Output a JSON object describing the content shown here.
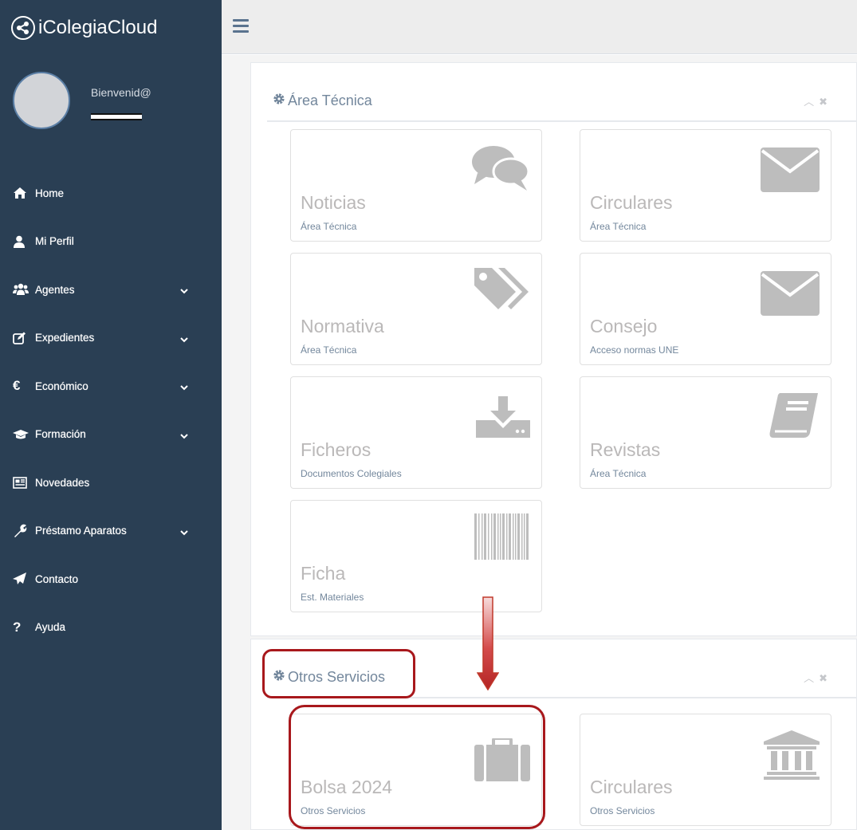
{
  "app": {
    "title": "iColegiaCloud"
  },
  "profile": {
    "welcome": "Bienvenid@"
  },
  "menu": [
    {
      "label": "Home",
      "icon": "home-icon",
      "has_submenu": false
    },
    {
      "label": "Mi Perfil",
      "icon": "user-icon",
      "has_submenu": false
    },
    {
      "label": "Agentes",
      "icon": "users-icon",
      "has_submenu": true
    },
    {
      "label": "Expedientes",
      "icon": "edit-icon",
      "has_submenu": true
    },
    {
      "label": "Económico",
      "icon": "euro-icon",
      "has_submenu": true
    },
    {
      "label": "Formación",
      "icon": "graduation-cap-icon",
      "has_submenu": true
    },
    {
      "label": "Novedades",
      "icon": "newspaper-icon",
      "has_submenu": false
    },
    {
      "label": "Préstamo Aparatos",
      "icon": "wrench-icon",
      "has_submenu": true
    },
    {
      "label": "Contacto",
      "icon": "paper-plane-icon",
      "has_submenu": false
    },
    {
      "label": "Ayuda",
      "icon": "question-icon",
      "has_submenu": false
    }
  ],
  "panels": {
    "area_tecnica": {
      "title": "Área Técnica",
      "tiles": [
        {
          "title": "Noticias",
          "subtitle": "Área Técnica",
          "icon": "comments-icon"
        },
        {
          "title": "Circulares",
          "subtitle": "Área Técnica",
          "icon": "envelope-icon"
        },
        {
          "title": "Normativa",
          "subtitle": "Área Técnica",
          "icon": "tags-icon"
        },
        {
          "title": "Consejo",
          "subtitle": "Acceso normas UNE",
          "icon": "envelope-icon"
        },
        {
          "title": "Ficheros",
          "subtitle": "Documentos Colegiales",
          "icon": "download-icon"
        },
        {
          "title": "Revistas",
          "subtitle": "Área Técnica",
          "icon": "book-icon"
        },
        {
          "title": "Ficha",
          "subtitle": "Est. Materiales",
          "icon": "barcode-icon"
        }
      ]
    },
    "otros_servicios": {
      "title": "Otros Servicios",
      "tiles": [
        {
          "title": "Bolsa 2024",
          "subtitle": "Otros Servicios",
          "icon": "briefcase-icon"
        },
        {
          "title": "Circulares",
          "subtitle": "Otros Servicios",
          "icon": "institution-icon"
        }
      ]
    }
  },
  "colors": {
    "sidebar": "#2a3f54",
    "highlight": "#a8181c",
    "tile_icon": "#bdbdbd",
    "muted_text": "#73879c"
  }
}
